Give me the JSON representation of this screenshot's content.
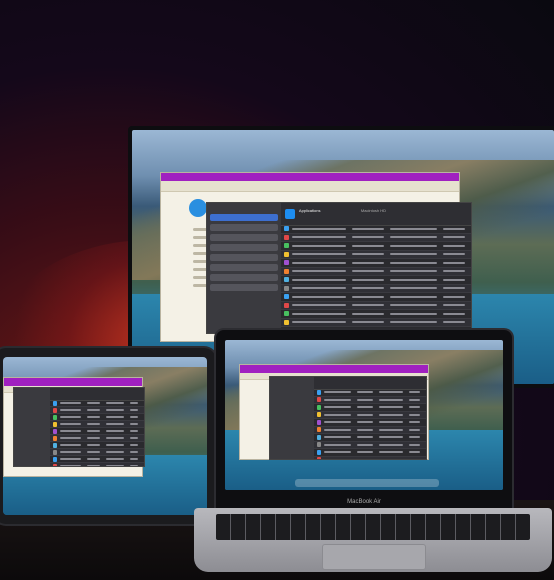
{
  "scene": "three devices showing the same app window",
  "monitor": {
    "app_title": "Applications",
    "storage_caption": "Macintosh HD",
    "rows": 15
  },
  "laptop": {
    "label": "MacBook Air"
  },
  "colors": {
    "window_titlebar": "#a020c0",
    "finder_dark": "#2a2a2e",
    "selection_blue": "#3d6fd0",
    "ambient_red": "#7a1c14"
  },
  "icons": [
    "app-store-icon",
    "dock-icons"
  ]
}
